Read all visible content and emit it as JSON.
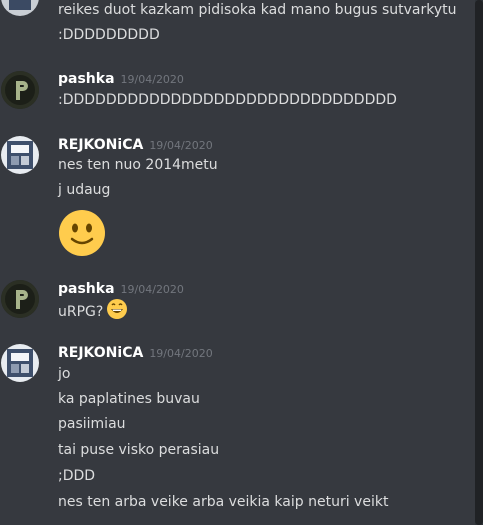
{
  "messages": {
    "top": {
      "lines": [
        "reikes duot kazkam pidisoka kad mano bugus sutvarkytu",
        ":DDDDDDDDD"
      ]
    },
    "group1": {
      "username": "pashka",
      "timestamp": "19/04/2020",
      "lines": [
        ":DDDDDDDDDDDDDDDDDDDDDDDDDDDDDDD"
      ]
    },
    "group2": {
      "username": "REJKONiCA",
      "timestamp": "19/04/2020",
      "lines": [
        "nes ten nuo 2014metu",
        "j udaug"
      ],
      "emoji": "slightly-smiling-face-icon"
    },
    "group3": {
      "username": "pashka",
      "timestamp": "19/04/2020",
      "lines": [
        "uRPG?"
      ],
      "emoji": "grinning-face-icon"
    },
    "group4": {
      "username": "REJKONiCA",
      "timestamp": "19/04/2020",
      "lines": [
        "jo",
        "ka paplatines buvau",
        "pasiimiau",
        "tai puse visko perasiau",
        ";DDD",
        "nes ten arba veike arba veikia kaip neturi veikt"
      ]
    }
  },
  "colors": {
    "background": "#36393f",
    "username": "#ffffff",
    "text": "#dcddde",
    "timestamp": "#72767d"
  }
}
